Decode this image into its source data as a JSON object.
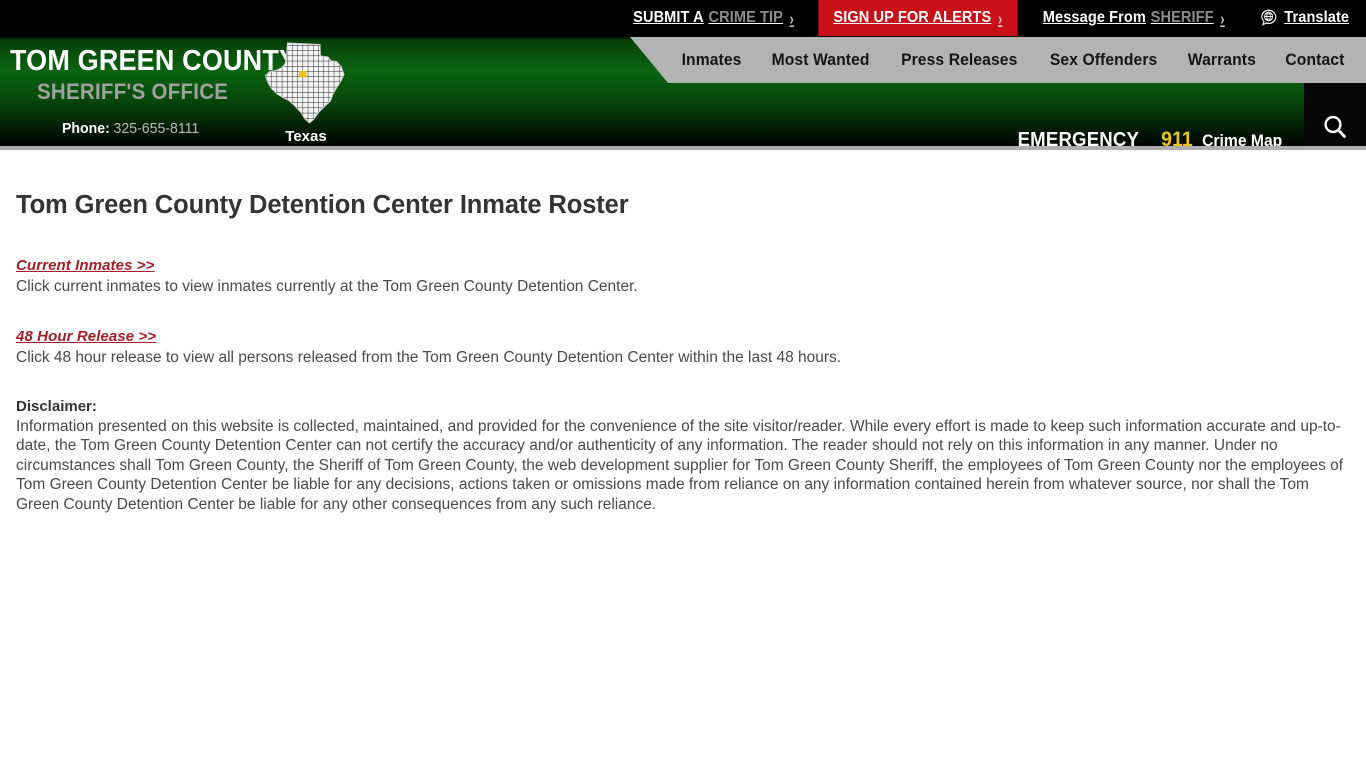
{
  "topbar": {
    "items": [
      {
        "name": "submit-crime-tip",
        "lead": "SUBMIT A",
        "muted": "CRIME TIP",
        "chevron": "›",
        "style": "plain"
      },
      {
        "name": "sign-up-alerts",
        "lead": "SIGN UP FOR ALERTS",
        "muted": "",
        "chevron": "›",
        "style": "alerts"
      },
      {
        "name": "message-from-sheriff",
        "lead": "Message From",
        "muted": "SHERIFF",
        "chevron": "›",
        "style": "plain"
      }
    ],
    "submit_lead": "SUBMIT A",
    "submit_muted": "CRIME TIP",
    "alerts_label": "SIGN UP FOR ALERTS",
    "sheriff_lead": "Message From",
    "sheriff_muted": "SHERIFF",
    "translate_label": "Translate",
    "chevron": "›",
    "alerts_bg": "#c91019"
  },
  "header": {
    "county_name": "TOM GREEN COUNTY",
    "office_name": "SHERIFF'S OFFICE",
    "phone_label": "Phone:",
    "phone_number": "325-655-8111",
    "state_label": "Texas",
    "emergency_word": "EMERGENCY",
    "emergency_number": "911",
    "crime_map_label": "Crime Map",
    "emergency_number_color": "#e8c51c",
    "nav_bg": "#b3b3b3"
  },
  "nav": {
    "items": [
      {
        "label": "Inmates",
        "name": "nav-item-inmates"
      },
      {
        "label": "Most Wanted",
        "name": "nav-item-most-wanted"
      },
      {
        "label": "Press Releases",
        "name": "nav-item-press-releases"
      },
      {
        "label": "Sex Offenders",
        "name": "nav-item-sex-offenders"
      },
      {
        "label": "Warrants",
        "name": "nav-item-warrants"
      },
      {
        "label": "Contact",
        "name": "nav-item-contact"
      }
    ],
    "item_0": "Inmates",
    "item_1": "Most Wanted",
    "item_2": "Press Releases",
    "item_3": "Sex Offenders",
    "item_4": "Warrants",
    "item_5": "Contact"
  },
  "icons": {
    "search": "search-icon",
    "accessibility": "accessibility-icon",
    "globe": "globe-translate-icon"
  },
  "main": {
    "page_title": "Tom Green County Detention Center Inmate Roster",
    "current_inmates_link": "Current Inmates >>",
    "current_inmates_desc": "Click current inmates to view inmates currently at the Tom Green County Detention Center.",
    "release_link": "48 Hour Release >>",
    "release_desc": "Click 48 hour release to view all persons released from the Tom Green County Detention Center within the last 48 hours.",
    "disclaimer_label": "Disclaimer:",
    "disclaimer_text": "Information presented on this website is collected, maintained, and provided for the convenience of the site visitor/reader. While every effort is made to keep such information accurate and up-to-date, the Tom Green County Detention Center can not certify the accuracy and/or authenticity of any information. The reader should not rely on this information in any manner.  Under no circumstances shall Tom Green County, the Sheriff of Tom Green County, the web development supplier for Tom Green County Sheriff, the employees of Tom Green County nor the employees of Tom Green County Detention Center be liable for any decisions, actions taken or omissions made from reliance on any information contained herein from whatever source, nor shall the Tom Green County Detention Center be liable for any other consequences from any such reliance.",
    "link_color": "#a32026"
  }
}
